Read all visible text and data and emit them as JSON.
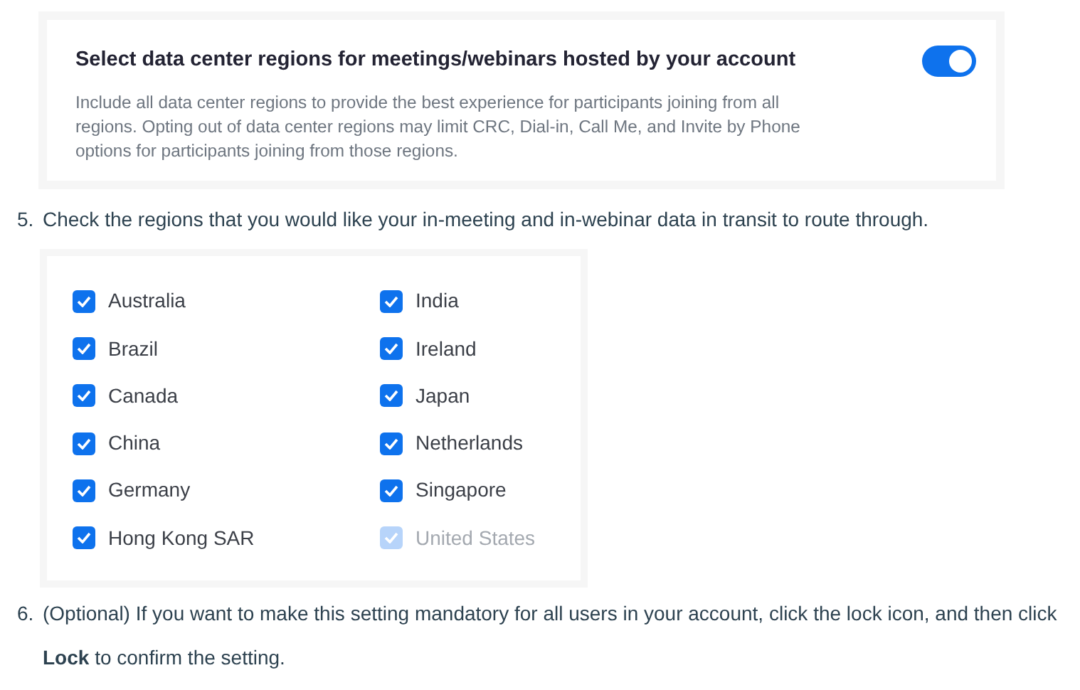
{
  "setting": {
    "title": "Select data center regions for meetings/webinars hosted by your account",
    "description": "Include all data center regions to provide the best experience for participants joining from all regions. Opting out of data center regions may limit CRC, Dial-in, Call Me, and Invite by Phone options for participants joining from those regions.",
    "on": true
  },
  "steps": [
    {
      "number": "5.",
      "text": "Check the regions that you would like your in-meeting and in-webinar data in transit to route through."
    },
    {
      "number": "6.",
      "text": "(Optional) If you want to make this setting mandatory for all users in your account, click the lock icon, and then click **Lock** to confirm the setting."
    }
  ],
  "regions": [
    {
      "label": "Australia",
      "checked": true,
      "disabled": false
    },
    {
      "label": "Brazil",
      "checked": true,
      "disabled": false
    },
    {
      "label": "Canada",
      "checked": true,
      "disabled": false
    },
    {
      "label": "China",
      "checked": true,
      "disabled": false
    },
    {
      "label": "Germany",
      "checked": true,
      "disabled": false
    },
    {
      "label": "Hong Kong SAR",
      "checked": true,
      "disabled": false
    },
    {
      "label": "India",
      "checked": true,
      "disabled": false
    },
    {
      "label": "Ireland",
      "checked": true,
      "disabled": false
    },
    {
      "label": "Japan",
      "checked": true,
      "disabled": false
    },
    {
      "label": "Netherlands",
      "checked": true,
      "disabled": false
    },
    {
      "label": "Singapore",
      "checked": true,
      "disabled": false
    },
    {
      "label": "United States",
      "checked": true,
      "disabled": true
    }
  ]
}
